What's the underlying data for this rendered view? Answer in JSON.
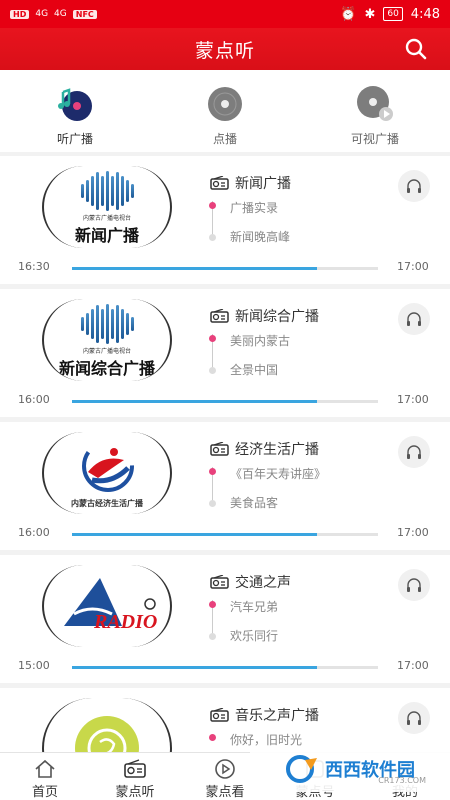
{
  "status_bar": {
    "left": [
      "HD",
      "4G",
      "4G",
      "NFC"
    ],
    "time": "4:48",
    "battery": "60"
  },
  "header": {
    "title": "蒙点听"
  },
  "tabs": [
    {
      "label": "听广播",
      "active": true
    },
    {
      "label": "点播",
      "active": false
    },
    {
      "label": "可视广播",
      "active": false
    }
  ],
  "stations": [
    {
      "logo_small": "内蒙古广播电视台",
      "logo_big": "新闻广播",
      "name": "新闻广播",
      "now": "广播实录",
      "next": "新闻晚高峰",
      "start": "16:30",
      "end": "17:00",
      "progress": 0.8
    },
    {
      "logo_small": "内蒙古广播电视台",
      "logo_big": "新闻综合广播",
      "name": "新闻综合广播",
      "now": "美丽内蒙古",
      "next": "全景中国",
      "start": "16:00",
      "end": "17:00",
      "progress": 0.8
    },
    {
      "logo_small": "内蒙古经济生活广播",
      "logo_big": "",
      "name": "经济生活广播",
      "now": "《百年天寿讲座》",
      "next": "美食品客",
      "start": "16:00",
      "end": "17:00",
      "progress": 0.8
    },
    {
      "logo_small": "RADIO",
      "logo_big": "",
      "name": "交通之声",
      "now": "汽车兄弟",
      "next": "欢乐同行",
      "start": "15:00",
      "end": "17:00",
      "progress": 0.8
    },
    {
      "logo_small": "",
      "logo_big": "",
      "name": "音乐之声广播",
      "now": "你好，旧时光",
      "next": "",
      "start": "",
      "end": "",
      "progress": 0
    }
  ],
  "bottom_nav": [
    {
      "label": "首页",
      "icon": "home-icon"
    },
    {
      "label": "蒙点听",
      "icon": "radio-icon"
    },
    {
      "label": "蒙点看",
      "icon": "play-icon"
    },
    {
      "label": "蒙点号",
      "icon": "account-icon"
    },
    {
      "label": "我的",
      "icon": "user-icon"
    }
  ],
  "watermark": {
    "text": "西西软件园",
    "sub": "CR173.COM"
  },
  "colors": {
    "brand_red": "#e60012",
    "progress_blue": "#3aa5e0",
    "now_dot": "#e8417c"
  }
}
